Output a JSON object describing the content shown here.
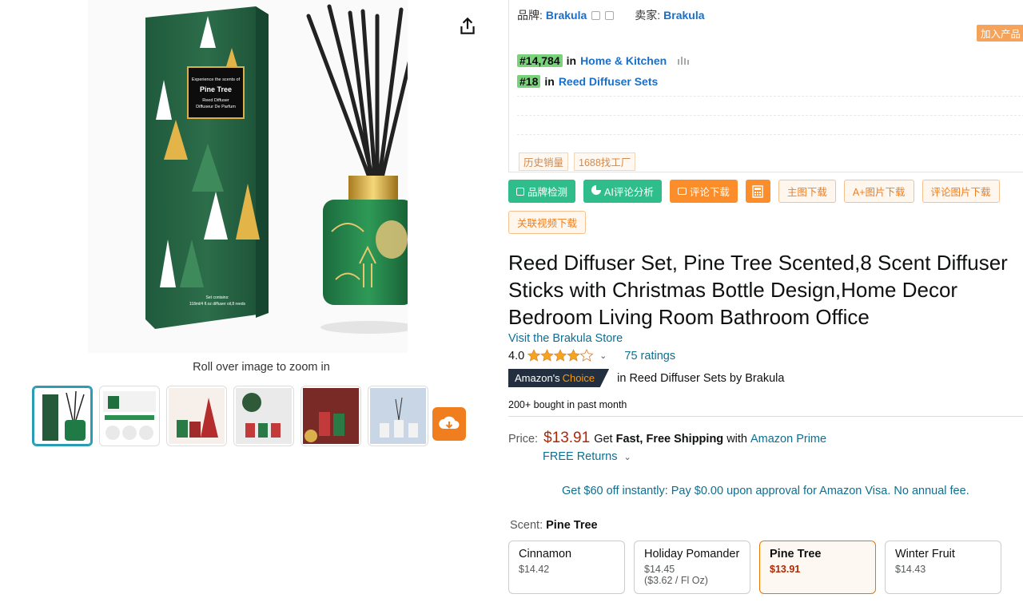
{
  "gallery": {
    "zoom_hint": "Roll over image to zoom in",
    "box_heading": "Experience the scents of",
    "box_name": "Pine Tree",
    "box_subtitle": "Reed Diffuser",
    "box_subtitle2": "Diffuseur De Parfum",
    "box_contents_label": "Set contains:",
    "box_contents": "118ml/4 fl.oz diffuser oil,8 reeds",
    "thumbnails": [
      "thumb-1",
      "thumb-2",
      "thumb-3",
      "thumb-4",
      "thumb-5",
      "thumb-6"
    ]
  },
  "plugin": {
    "brand_label": "品牌:",
    "brand_value": "Brakula",
    "seller_label": "卖家:",
    "seller_value": "Brakula",
    "add_product": "加入产品",
    "rank1_num": "#14,784",
    "rank1_in": "in",
    "rank1_cat": "Home & Kitchen",
    "rank2_num": "#18",
    "rank2_in": "in",
    "rank2_cat": "Reed Diffuser Sets",
    "tag_history": "历史销量",
    "tag_factory": "1688找工厂",
    "buttons": {
      "brand_check": "品牌检测",
      "ai_review": "AI评论分析",
      "review_download": "评论下载",
      "main_image_download": "主图下载",
      "aplus_download": "A+图片下载",
      "review_image_download": "评论图片下载",
      "video_download": "关联视频下载"
    }
  },
  "product": {
    "title": "Reed Diffuser Set, Pine Tree Scented,8 Scent Diffuser Sticks with Christmas Bottle Design,Home Decor Bedroom Living Room Bathroom Office",
    "store_link": "Visit the Brakula Store",
    "rating": "4.0",
    "ratings_count": "75 ratings",
    "choice_prefix": "Amazon's",
    "choice_suffix": "Choice",
    "choice_text": "in Reed Diffuser Sets by Brakula",
    "bought": "200+ bought in past month",
    "price_label": "Price:",
    "price": "$13.91",
    "ship_prefix": "Get",
    "ship_bold": "Fast, Free Shipping",
    "ship_with": "with",
    "prime": "Amazon Prime",
    "returns": "FREE Returns",
    "visa": "Get $60 off instantly: Pay $0.00 upon approval for Amazon Visa. No annual fee.",
    "scent_label": "Scent:",
    "scent_selected": "Pine Tree",
    "scents": [
      {
        "name": "Cinnamon",
        "price": "$14.42",
        "unit": ""
      },
      {
        "name": "Holiday Pomander",
        "price": "$14.45",
        "unit": "($3.62 / Fl Oz)"
      },
      {
        "name": "Pine Tree",
        "price": "$13.91",
        "unit": ""
      },
      {
        "name": "Winter Fruit",
        "price": "$14.43",
        "unit": ""
      }
    ]
  },
  "colors": {
    "link": "#0e6f90",
    "price": "#b12704",
    "plugin_green": "#2ebd8b",
    "plugin_orange": "#fb8e2a",
    "star": "#f4a41d"
  }
}
